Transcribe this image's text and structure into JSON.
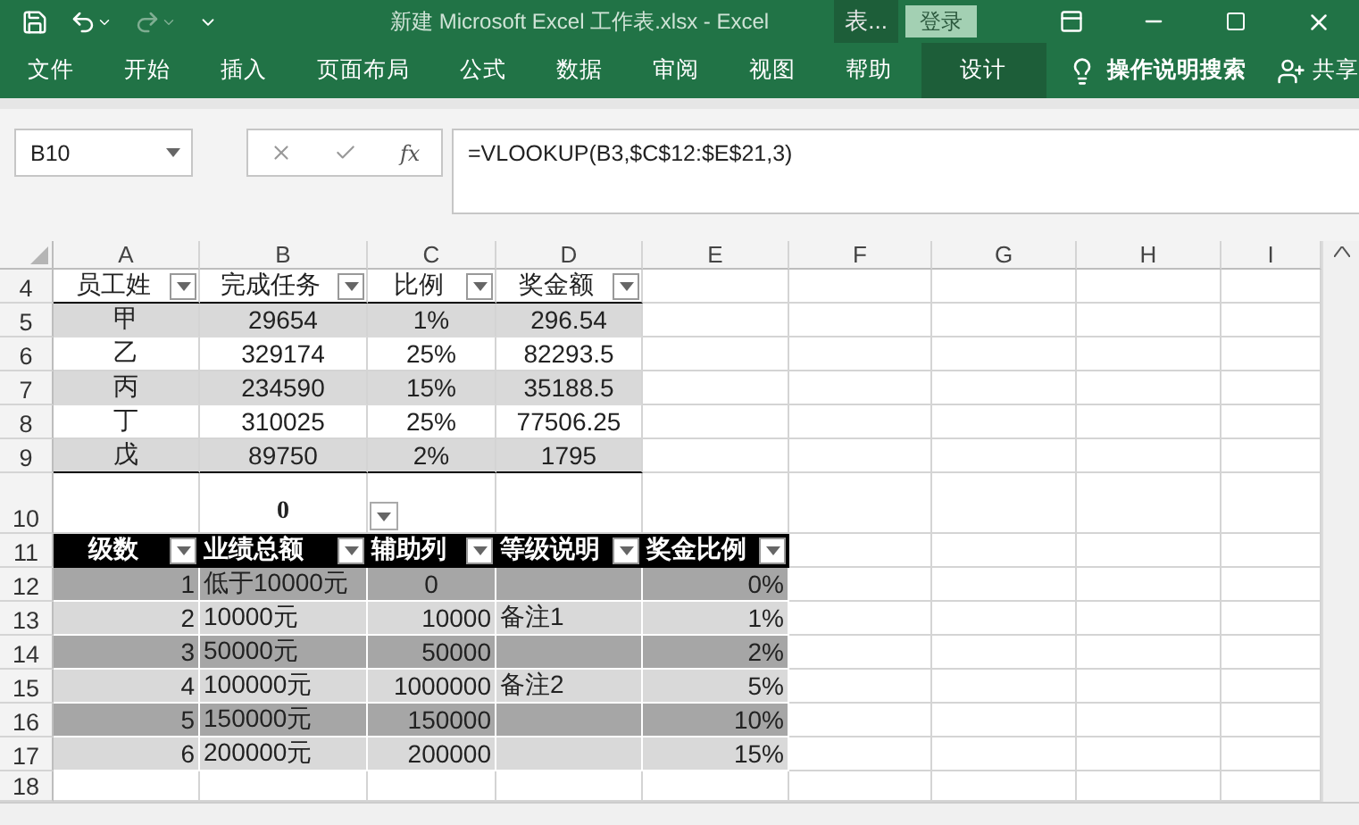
{
  "title_bar": {
    "title": "新建 Microsoft Excel 工作表.xlsx  -  Excel",
    "context_tab": "表...",
    "login": "登录"
  },
  "ribbon": {
    "tabs": [
      {
        "label": "文件",
        "selected": false
      },
      {
        "label": "开始",
        "selected": false
      },
      {
        "label": "插入",
        "selected": false
      },
      {
        "label": "页面布局",
        "selected": false
      },
      {
        "label": "公式",
        "selected": false
      },
      {
        "label": "数据",
        "selected": false
      },
      {
        "label": "审阅",
        "selected": false
      },
      {
        "label": "视图",
        "selected": false
      },
      {
        "label": "帮助",
        "selected": false
      },
      {
        "label": "设计",
        "selected": true
      }
    ],
    "tell_me": "操作说明搜索",
    "share": "共享"
  },
  "formula_bar": {
    "name_box": "B10",
    "fx": "fx",
    "formula": "=VLOOKUP(B3,$C$12:$E$21,3)"
  },
  "sheet": {
    "columns": [
      "A",
      "B",
      "C",
      "D",
      "E",
      "F",
      "G",
      "H",
      "I"
    ],
    "rows": [
      {
        "number": "4",
        "kind": "filter-header",
        "cells": [
          "员工姓",
          "完成任务",
          "比例",
          "奖金额"
        ]
      },
      {
        "number": "5",
        "kind": "record",
        "shaded": true,
        "cells": [
          "甲",
          "29654",
          "1%",
          "296.54"
        ]
      },
      {
        "number": "6",
        "kind": "record",
        "shaded": false,
        "cells": [
          "乙",
          "329174",
          "25%",
          "82293.5"
        ]
      },
      {
        "number": "7",
        "kind": "record",
        "shaded": true,
        "cells": [
          "丙",
          "234590",
          "15%",
          "35188.5"
        ]
      },
      {
        "number": "8",
        "kind": "record",
        "shaded": false,
        "cells": [
          "丁",
          "310025",
          "25%",
          "77506.25"
        ]
      },
      {
        "number": "9",
        "kind": "record",
        "shaded": true,
        "cells": [
          "戊",
          "89750",
          "2%",
          "1795"
        ]
      },
      {
        "number": "10",
        "kind": "input",
        "value": "0"
      },
      {
        "number": "11",
        "kind": "dark-header",
        "cells": [
          "级数",
          "业绩总额",
          "辅助列",
          "等级说明",
          "奖金比例"
        ]
      },
      {
        "number": "12",
        "kind": "grade",
        "shaded": true,
        "helper_centered": true,
        "grade": "1",
        "amount": "低于10000元",
        "helper": "0",
        "rate": "0%"
      },
      {
        "number": "13",
        "kind": "grade",
        "shaded": false,
        "helper_centered": false,
        "grade": "2",
        "amount": "10000元",
        "helper": "10000",
        "note": "备注1",
        "rate": "1%"
      },
      {
        "number": "14",
        "kind": "grade",
        "shaded": true,
        "helper_centered": false,
        "grade": "3",
        "amount": "50000元",
        "helper": "50000",
        "rate": "2%"
      },
      {
        "number": "15",
        "kind": "grade",
        "shaded": false,
        "helper_centered": false,
        "grade": "4",
        "amount": "100000元",
        "helper": "1000000",
        "note": "备注2",
        "rate": "5%"
      },
      {
        "number": "16",
        "kind": "grade",
        "shaded": true,
        "helper_centered": false,
        "grade": "5",
        "amount": "150000元",
        "helper": "150000",
        "rate": "10%"
      },
      {
        "number": "17",
        "kind": "grade",
        "shaded": false,
        "helper_centered": false,
        "grade": "6",
        "amount": "200000元",
        "helper": "200000",
        "rate": "15%"
      },
      {
        "number": "18",
        "kind": "blank"
      }
    ]
  }
}
